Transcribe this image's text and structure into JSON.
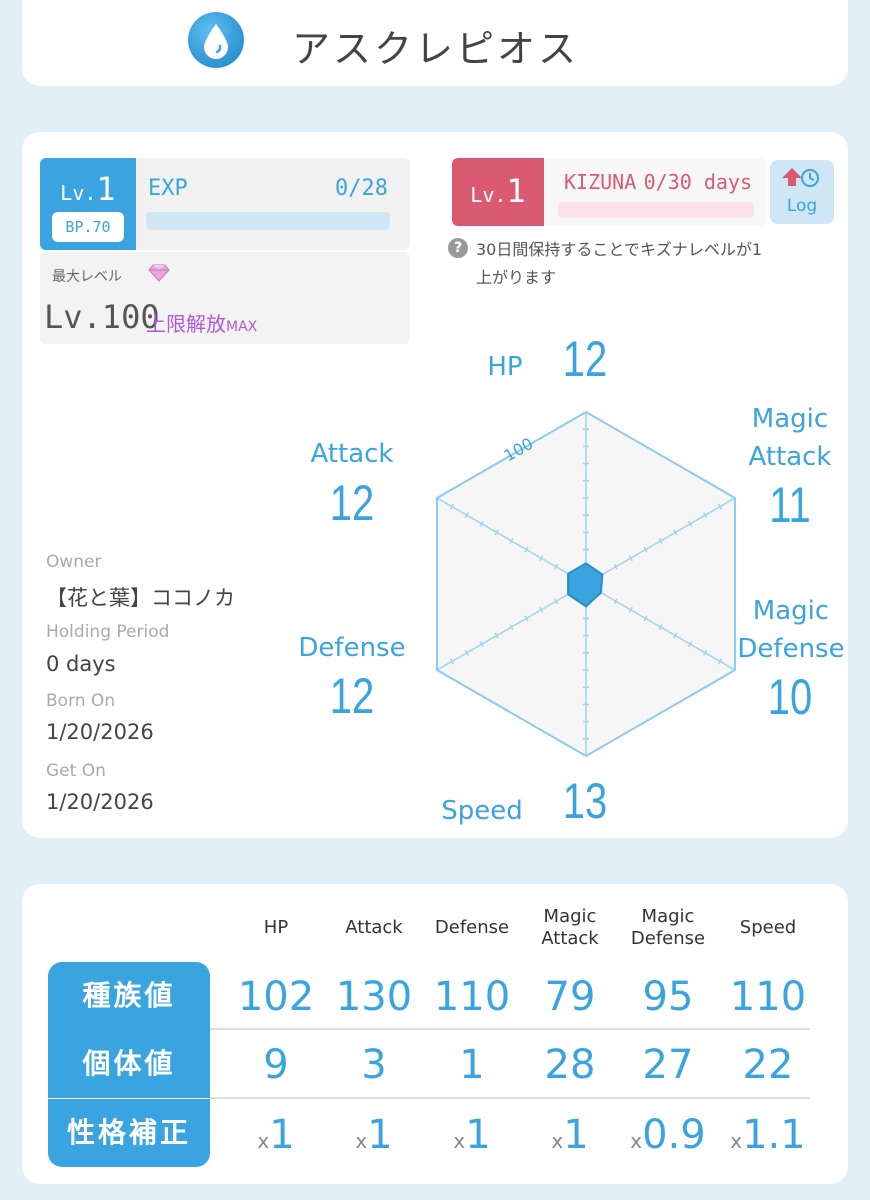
{
  "character": {
    "name": "アスクレピオス",
    "element_icon": "water-drop-icon"
  },
  "level": {
    "prefix": "Lv.",
    "value": "1",
    "bp": "BP.70",
    "exp_label": "EXP",
    "exp_value": "0/28",
    "exp_progress": 0
  },
  "max_level": {
    "label": "最大レベル",
    "value": "Lv.100",
    "limit_text": "上限解放",
    "limit_suffix": "MAX"
  },
  "kizuna": {
    "prefix": "Lv.",
    "value": "1",
    "label": "KIZUNA",
    "progress_text": "0/30 days",
    "progress": 0,
    "help": "30日間保持することでキズナレベルが1上がります"
  },
  "log_button": {
    "label": "Log"
  },
  "radar": {
    "scale_label": "100",
    "stats": [
      {
        "label": "HP",
        "value": "12"
      },
      {
        "label": "Magic Attack",
        "value": "11"
      },
      {
        "label": "Magic Defense",
        "value": "10"
      },
      {
        "label": "Speed",
        "value": "13"
      },
      {
        "label": "Defense",
        "value": "12"
      },
      {
        "label": "Attack",
        "value": "12"
      }
    ]
  },
  "info": {
    "owner_label": "Owner",
    "owner": "【花と葉】ココノカ",
    "holding_label": "Holding Period",
    "holding": "0 days",
    "born_label": "Born On",
    "born": "1/20/2026",
    "get_label": "Get On",
    "get": "1/20/2026"
  },
  "table": {
    "headers": [
      "HP",
      "Attack",
      "Defense",
      "Magic Attack",
      "Magic Defense",
      "Speed"
    ],
    "rows": [
      {
        "label": "種族値",
        "values": [
          "102",
          "130",
          "110",
          "79",
          "95",
          "110"
        ]
      },
      {
        "label": "個体値",
        "values": [
          "9",
          "3",
          "1",
          "28",
          "27",
          "22"
        ]
      },
      {
        "label": "性格補正",
        "prefix": "x",
        "values": [
          "1",
          "1",
          "1",
          "1",
          "0.9",
          "1.1"
        ]
      }
    ]
  },
  "colors": {
    "accent": "#3aa4e0",
    "kizuna": "#d95a72",
    "limit": "#b05ad6"
  }
}
